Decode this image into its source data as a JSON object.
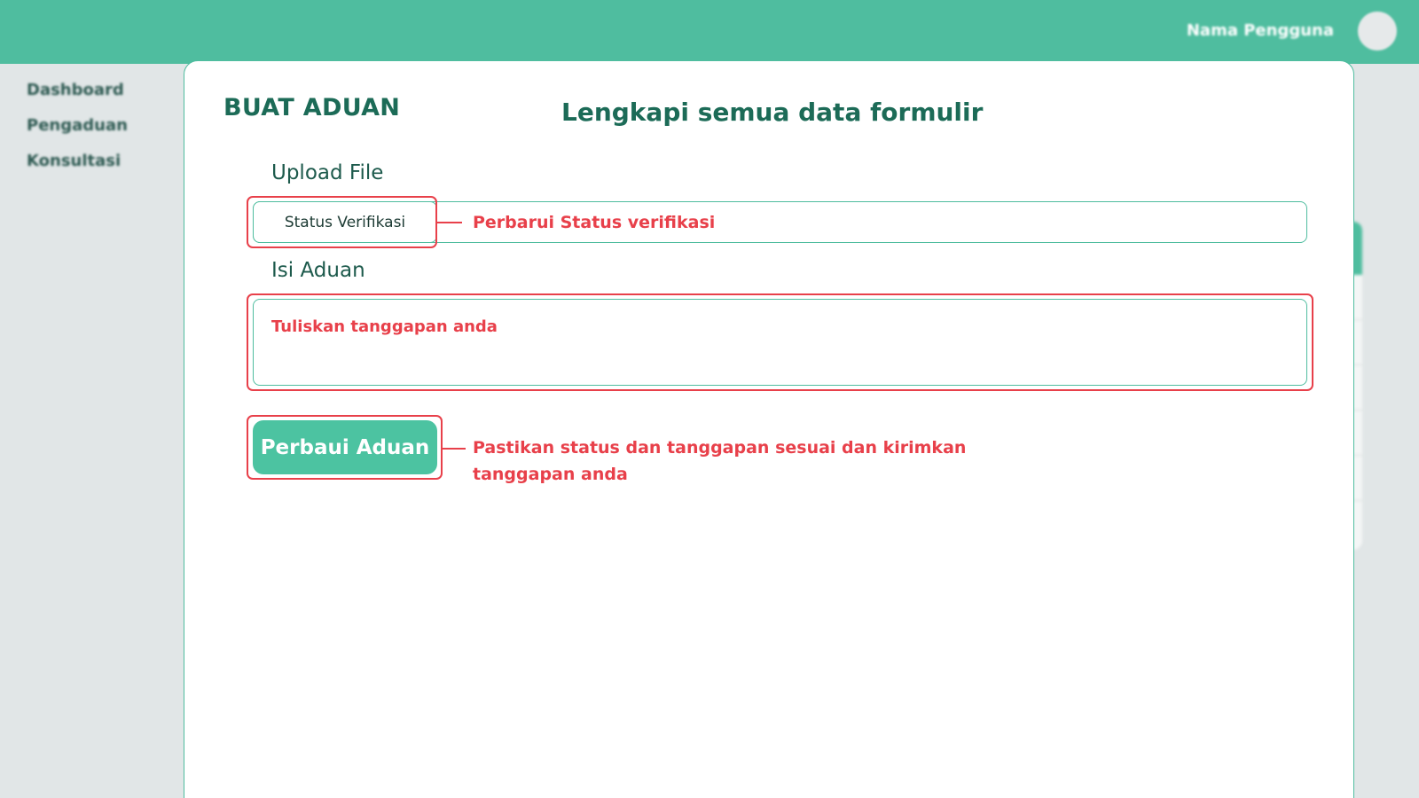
{
  "header": {
    "user_name": "Nama Pengguna"
  },
  "sidebar": {
    "items": [
      {
        "label": "Dashboard"
      },
      {
        "label": "Pengaduan"
      },
      {
        "label": "Konsultasi"
      }
    ]
  },
  "form": {
    "title": "BUAT ADUAN",
    "instruction": "Lengkapi semua data formulir",
    "upload_label": "Upload File",
    "status_button_label": "Status Verifikasi",
    "isi_label": "Isi Aduan",
    "isi_placeholder": "Tuliskan tanggapan anda",
    "submit_label": "Perbaui Aduan"
  },
  "annotations": {
    "status_note": "Perbarui Status verifikasi",
    "submit_note": "Pastikan status dan tanggapan sesuai dan kirimkan tanggapan anda",
    "color": "#e8404a"
  },
  "colors": {
    "primary": "#4fbd9f",
    "primary_dark": "#1c6b57",
    "button": "#4cc3a1",
    "annotation": "#e8404a",
    "background": "#e1e6e7"
  }
}
